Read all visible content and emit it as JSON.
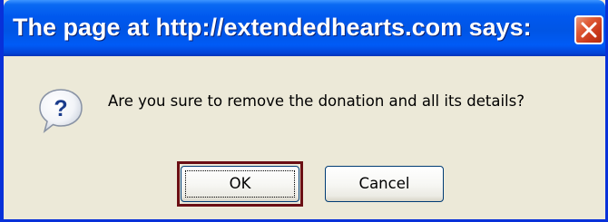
{
  "dialog": {
    "title": "The page at http://extendedhearts.com says:",
    "message": "Are you sure to remove the donation and all its details?",
    "icon": "question-icon",
    "close_icon": "close-icon",
    "buttons": {
      "ok_label": "OK",
      "cancel_label": "Cancel"
    }
  },
  "colors": {
    "titlebar": "#0055e5",
    "dialog_background": "#ece9d8",
    "close_button": "#df5a35",
    "ok_highlight": "#6b0f14"
  }
}
